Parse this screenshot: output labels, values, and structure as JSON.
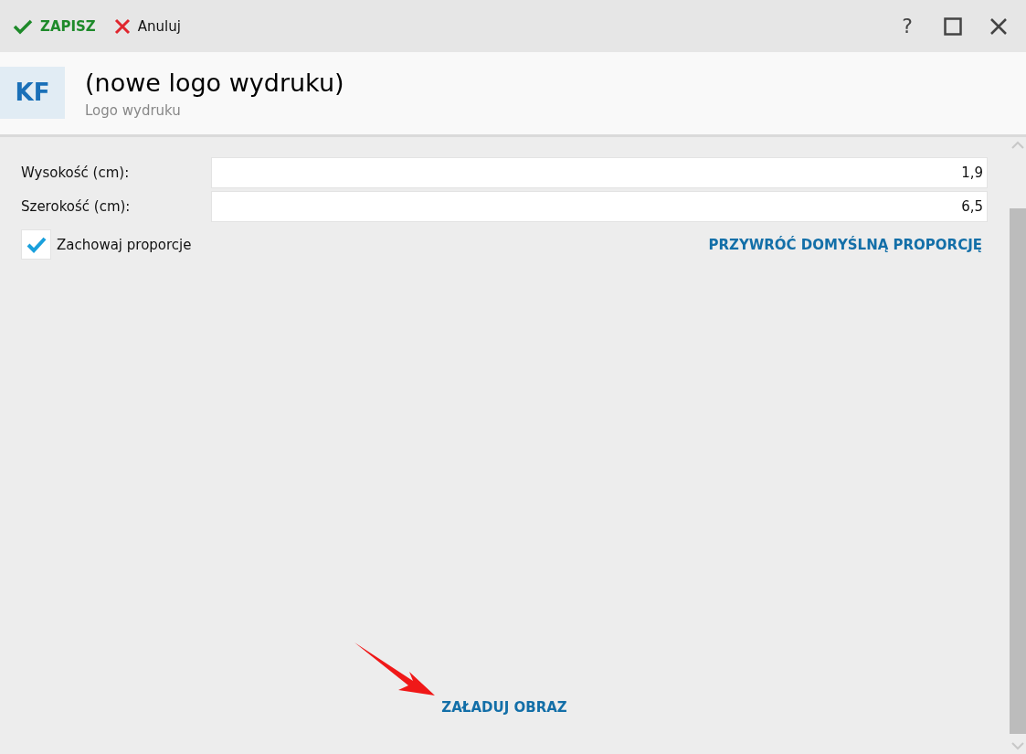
{
  "toolbar": {
    "save_label": "ZAPISZ",
    "cancel_label": "Anuluj",
    "help_label": "?"
  },
  "header": {
    "badge": "KF",
    "title": "(nowe logo wydruku)",
    "subtitle": "Logo wydruku"
  },
  "fields": [
    {
      "label": "Wysokość (cm):",
      "value": "1,9"
    },
    {
      "label": "Szerokość (cm):",
      "value": "6,5"
    }
  ],
  "keep_ratio": {
    "label": "Zachowaj proporcje",
    "checked": true
  },
  "reset_link": "PRZYWRÓĆ DOMYŚLNĄ PROPORCJĘ",
  "load_link": "ZAŁADUJ OBRAZ"
}
